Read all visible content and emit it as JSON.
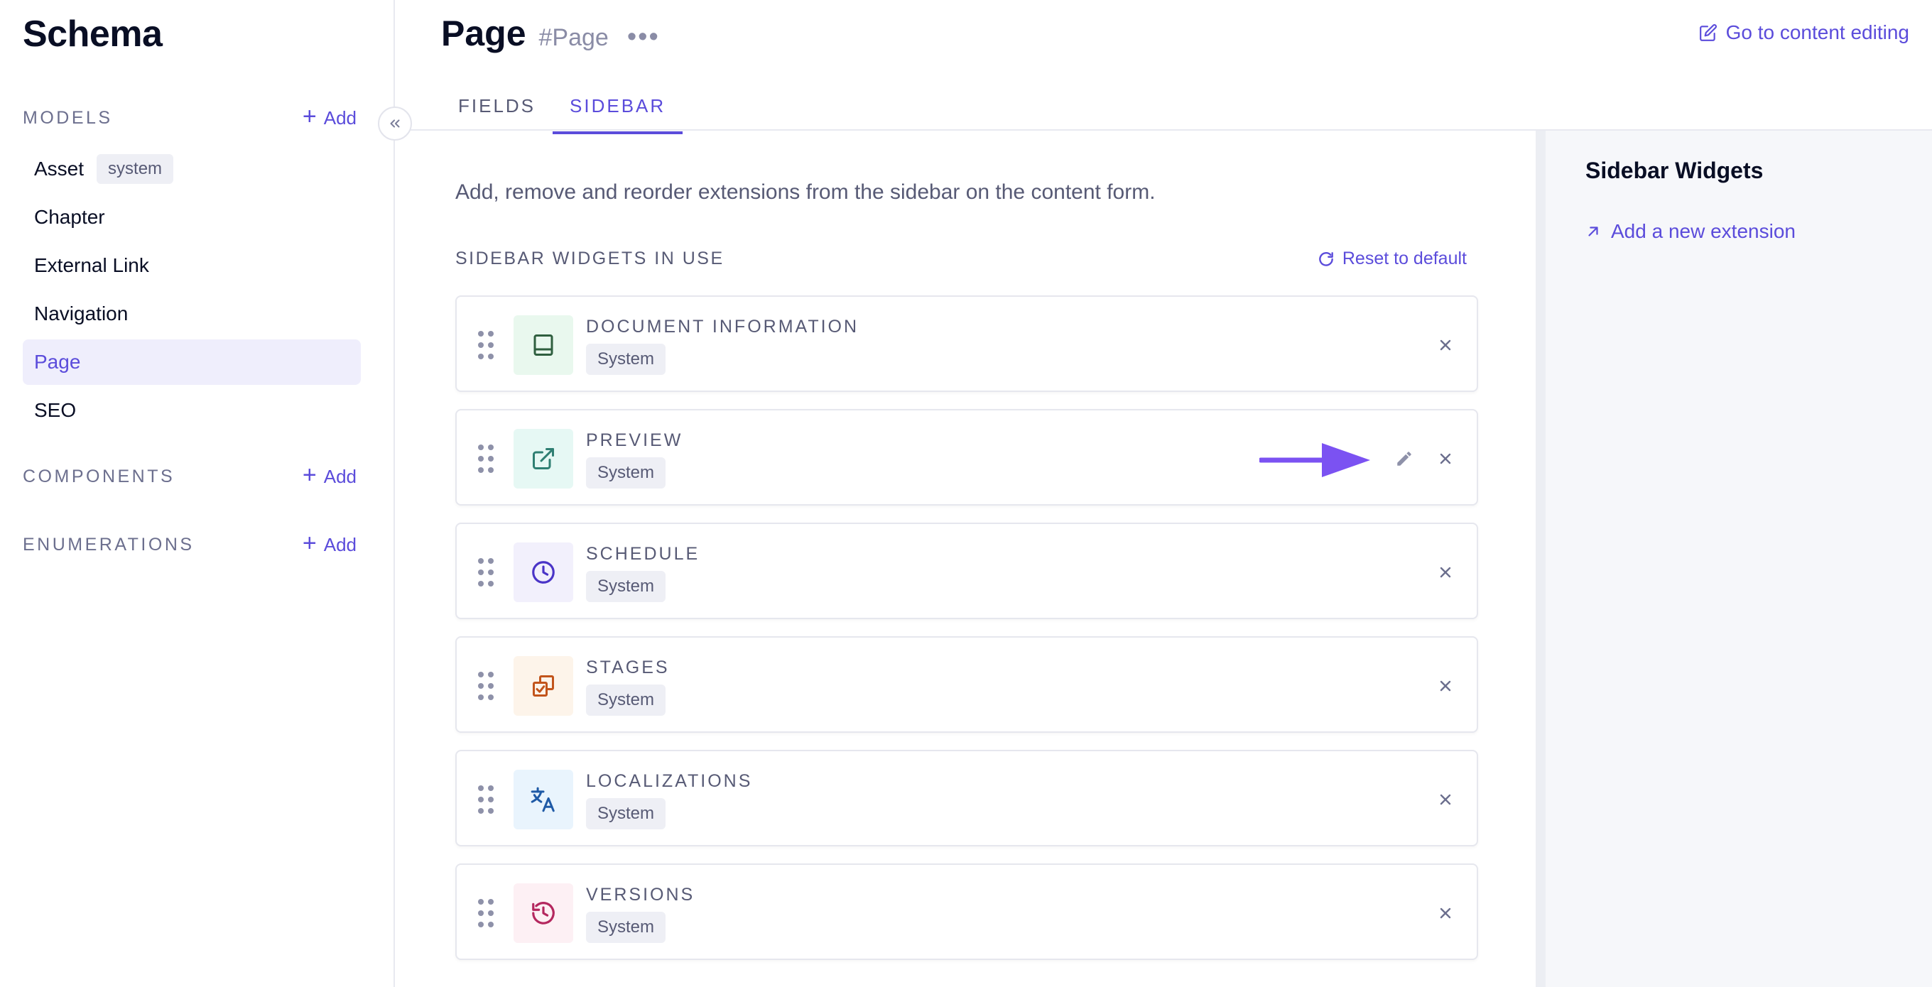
{
  "sidebar": {
    "title": "Schema",
    "collapse_icon": "double-chevron-left-icon",
    "models": {
      "label": "MODELS",
      "add_label": "Add",
      "items": [
        {
          "label": "Asset",
          "badge": "system"
        },
        {
          "label": "Chapter"
        },
        {
          "label": "External Link"
        },
        {
          "label": "Navigation"
        },
        {
          "label": "Page",
          "active": true
        },
        {
          "label": "SEO"
        }
      ]
    },
    "components": {
      "label": "COMPONENTS",
      "add_label": "Add"
    },
    "enumerations": {
      "label": "ENUMERATIONS",
      "add_label": "Add"
    }
  },
  "header": {
    "title": "Page",
    "api_id": "#Page",
    "more": "•••",
    "go_to_content": "Go to content editing",
    "tabs": [
      {
        "label": "FIELDS"
      },
      {
        "label": "SIDEBAR",
        "active": true
      }
    ]
  },
  "main": {
    "description": "Add, remove and reorder extensions from the sidebar on the content form.",
    "in_use_label": "SIDEBAR WIDGETS IN USE",
    "reset_label": "Reset to default",
    "widgets": [
      {
        "name": "DOCUMENT INFORMATION",
        "badge": "System",
        "icon": "book-icon",
        "icon_bg": "#e9f8ee",
        "icon_color": "#2f5f3f"
      },
      {
        "name": "PREVIEW",
        "badge": "System",
        "icon": "external-link-icon",
        "icon_bg": "#e6f8f4",
        "icon_color": "#2f7f72",
        "editable": true
      },
      {
        "name": "SCHEDULE",
        "badge": "System",
        "icon": "clock-icon",
        "icon_bg": "#f2f0fc",
        "icon_color": "#4a34c7"
      },
      {
        "name": "STAGES",
        "badge": "System",
        "icon": "stages-icon",
        "icon_bg": "#fdf4ea",
        "icon_color": "#c2541b"
      },
      {
        "name": "LOCALIZATIONS",
        "badge": "System",
        "icon": "translate-icon",
        "icon_bg": "#e9f4fd",
        "icon_color": "#1f5aa6"
      },
      {
        "name": "VERSIONS",
        "badge": "System",
        "icon": "history-icon",
        "icon_bg": "#fdf0f4",
        "icon_color": "#b4275e"
      }
    ]
  },
  "right_panel": {
    "title": "Sidebar Widgets",
    "add_extension": "Add a new extension"
  },
  "colors": {
    "accent": "#5b4cdb",
    "annotation_arrow": "#7b52f2"
  }
}
